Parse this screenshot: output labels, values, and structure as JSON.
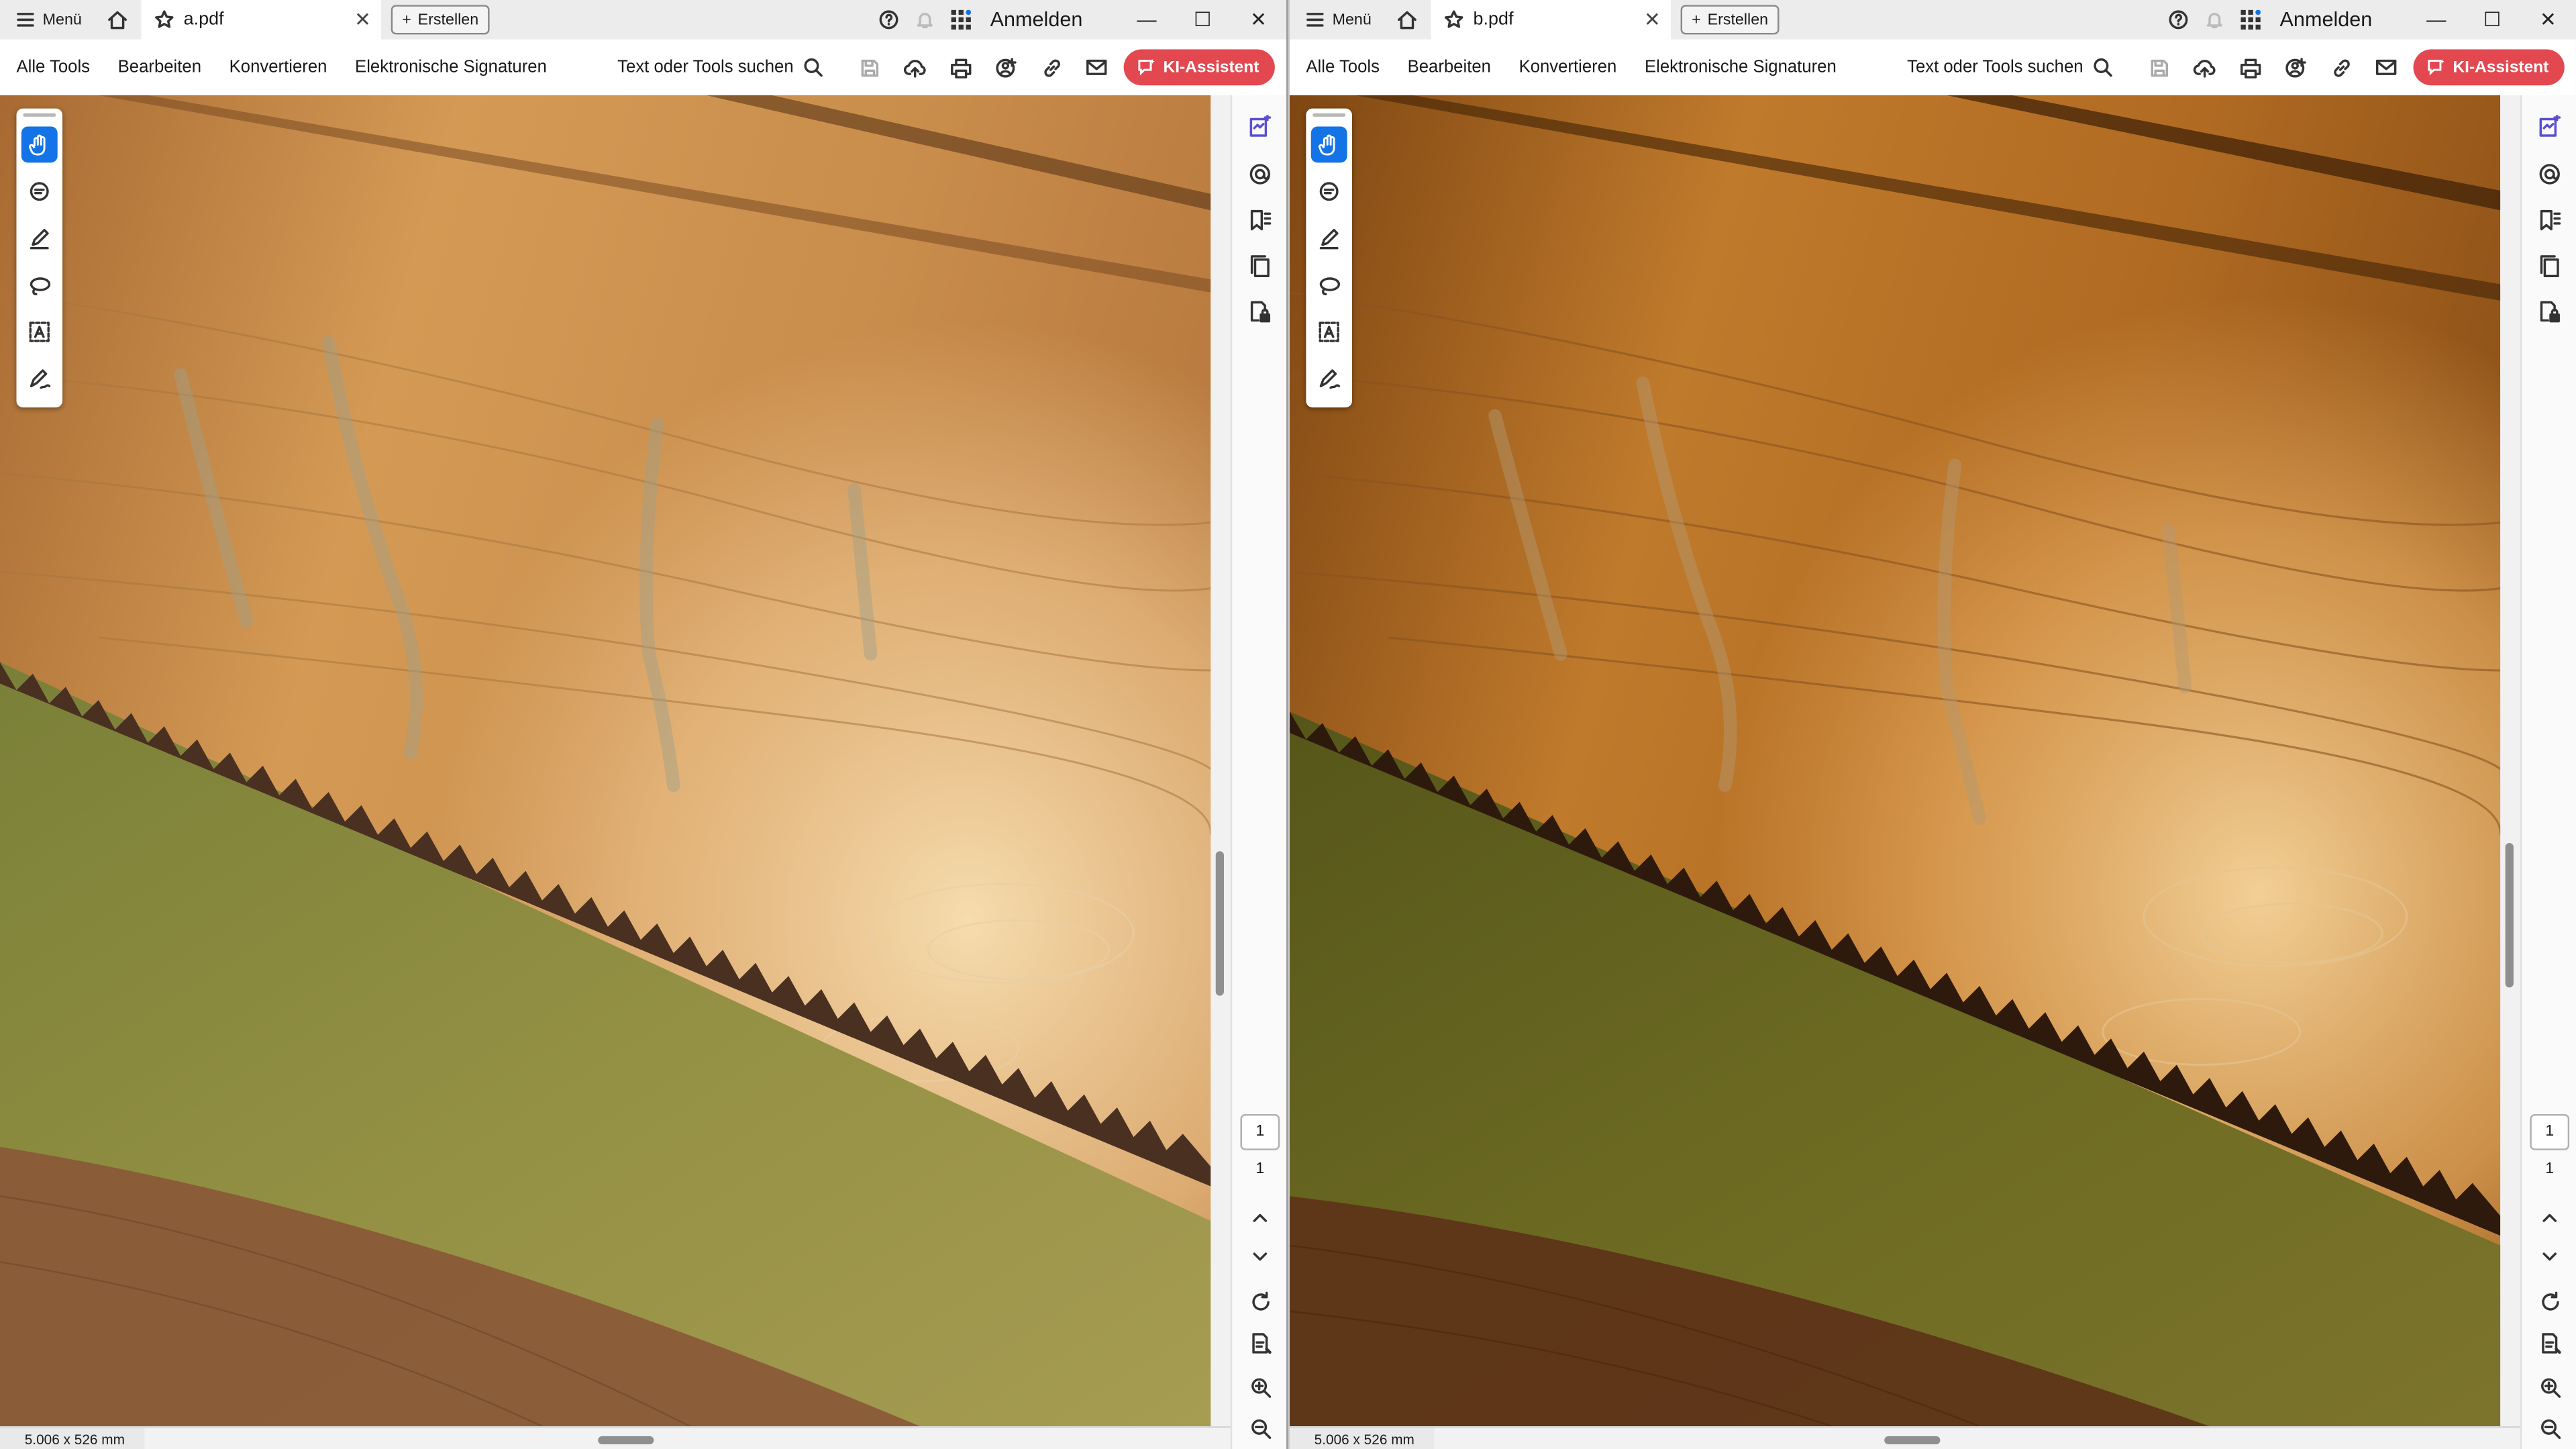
{
  "windows": [
    {
      "id": "left",
      "menu_label": "Menü",
      "tab_name": "a.pdf",
      "create_label": "Erstellen",
      "signin_label": "Anmelden",
      "menubar": [
        "Alle Tools",
        "Bearbeiten",
        "Konvertieren",
        "Elektronische Signaturen"
      ],
      "search_label": "Text oder Tools suchen",
      "ai_label": "KI-Assistent",
      "page_current": "1",
      "page_total": "1",
      "page_size": "5.006 x 526 mm"
    },
    {
      "id": "right",
      "menu_label": "Menü",
      "tab_name": "b.pdf",
      "create_label": "Erstellen",
      "signin_label": "Anmelden",
      "menubar": [
        "Alle Tools",
        "Bearbeiten",
        "Konvertieren",
        "Elektronische Signaturen"
      ],
      "search_label": "Text oder Tools suchen",
      "ai_label": "KI-Assistent",
      "page_current": "1",
      "page_total": "1",
      "page_size": "5.006 x 526 mm"
    }
  ],
  "icons": {
    "menu": "hamburger-icon",
    "home": "home-icon",
    "favorite": "star-icon",
    "close_tab": "close-icon",
    "add": "plus-icon",
    "help": "help-icon",
    "notifications": "bell-icon",
    "apps": "apps-grid-icon",
    "minimize": "minimize-icon",
    "maximize": "maximize-icon",
    "close_window": "close-icon",
    "search": "search-icon",
    "save": "save-icon",
    "upload": "cloud-upload-icon",
    "print": "print-icon",
    "share": "share-user-icon",
    "link": "link-icon",
    "email": "email-icon",
    "ai": "ai-chat-icon"
  },
  "colors": {
    "accent_blue": "#1473e6",
    "ai_button": "#e34850",
    "left_wood_light": "#e8b97a",
    "left_blade": "#8c8a3c",
    "right_wood_light": "#e3a45a",
    "right_blade": "#6e6a22"
  }
}
